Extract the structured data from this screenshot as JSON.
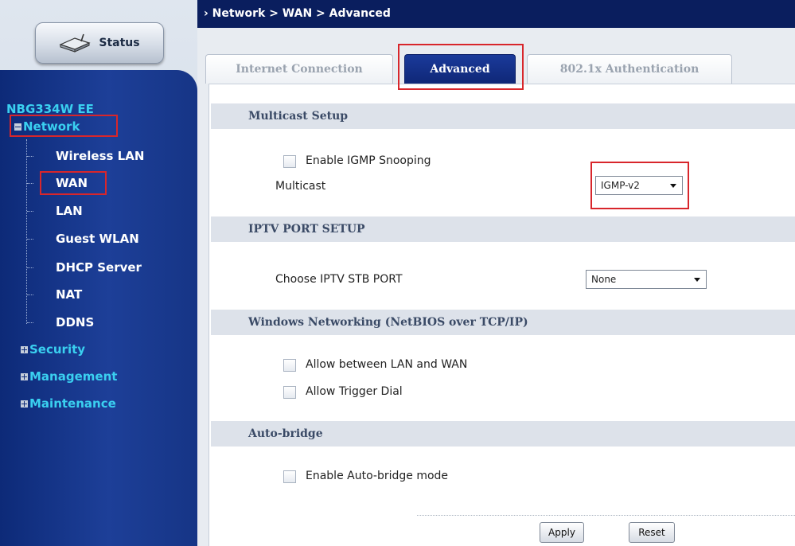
{
  "sidebar": {
    "status_label": "Status",
    "device_name": "NBG334W EE",
    "network_label": "Network",
    "sub_items": [
      {
        "label": "Wireless LAN"
      },
      {
        "label": "WAN"
      },
      {
        "label": "LAN"
      },
      {
        "label": "Guest WLAN"
      },
      {
        "label": "DHCP Server"
      },
      {
        "label": "NAT"
      },
      {
        "label": "DDNS"
      }
    ],
    "sections": [
      {
        "label": "Security"
      },
      {
        "label": "Management"
      },
      {
        "label": "Maintenance"
      }
    ]
  },
  "breadcrumb": "Network > WAN > Advanced",
  "tabs": [
    {
      "label": "Internet Connection"
    },
    {
      "label": "Advanced",
      "active": true
    },
    {
      "label": "802.1x Authentication"
    }
  ],
  "multicast": {
    "header": "Multicast Setup",
    "igmp_snooping_label": "Enable IGMP Snooping",
    "multicast_label": "Multicast",
    "multicast_value": "IGMP-v2"
  },
  "iptv": {
    "header": "IPTV PORT SETUP",
    "choose_label": "Choose IPTV STB PORT",
    "value": "None"
  },
  "netbios": {
    "header": "Windows Networking (NetBIOS over TCP/IP)",
    "allow_lan_wan": "Allow between LAN and WAN",
    "allow_trigger": "Allow Trigger Dial"
  },
  "autobridge": {
    "header": "Auto-bridge",
    "enable_label": "Enable Auto-bridge mode"
  },
  "buttons": {
    "apply": "Apply",
    "reset": "Reset"
  },
  "colors": {
    "highlight": "#d8262b",
    "nav_accent": "#3ad0f0",
    "sidebar": "#1d3f98"
  }
}
